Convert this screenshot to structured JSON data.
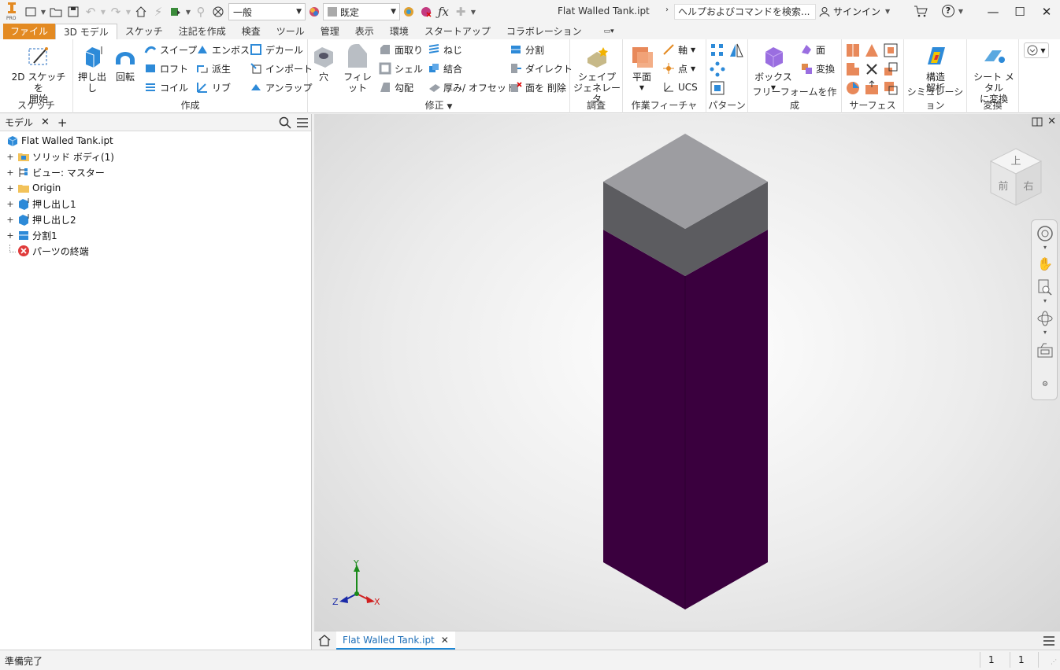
{
  "app": {
    "logo_text": "PRO",
    "style_dropdown": "一般",
    "appearance_dropdown": "既定",
    "document_title": "Flat Walled Tank.ipt",
    "help_search_placeholder": "ヘルプおよびコマンドを検索...",
    "signin_label": "サインイン"
  },
  "menu": {
    "tabs": [
      "ファイル",
      "3D モデル",
      "スケッチ",
      "注記を作成",
      "検査",
      "ツール",
      "管理",
      "表示",
      "環境",
      "スタートアップ",
      "コラボレーション"
    ]
  },
  "ribbon": {
    "sketch": {
      "start_line1": "2D スケッチを",
      "start_line2": "開始",
      "panel": "スケッチ"
    },
    "create": {
      "extrude": "押し出し",
      "revolve": "回転",
      "sweep": "スイープ",
      "loft": "ロフト",
      "coil": "コイル",
      "emboss": "エンボス",
      "derive": "派生",
      "rib": "リブ",
      "decal": "デカール",
      "import": "インポート",
      "unwrap": "アンラップ",
      "panel": "作成"
    },
    "modify": {
      "hole": "穴",
      "fillet": "フィレット",
      "chamfer": "面取り",
      "shell": "シェル",
      "draft": "勾配",
      "thread": "ねじ",
      "combine": "結合",
      "thicken": "厚み/ オフセット",
      "split": "分割",
      "direct": "ダイレクト",
      "delete_face": "面を 削除",
      "panel": "修正"
    },
    "explore": {
      "shape_line1": "シェイプ",
      "shape_line2": "ジェネレータ",
      "panel": "調査"
    },
    "work": {
      "plane": "平面",
      "axis": "軸",
      "point": "点",
      "ucs": "UCS",
      "panel": "作業フィーチャ"
    },
    "pattern": {
      "panel": "パターン"
    },
    "freeform": {
      "box": "ボックス",
      "face": "面",
      "convert": "変換",
      "panel": "フリーフォームを作成"
    },
    "surface": {
      "panel": "サーフェス"
    },
    "simulation": {
      "line1": "構造",
      "line2": "解析",
      "panel": "シミュレーション"
    },
    "convert": {
      "line1": "シート メタル",
      "line2": "に変換",
      "panel": "変換"
    }
  },
  "browser": {
    "title": "モデル",
    "items": [
      {
        "label": "Flat Walled Tank.ipt"
      },
      {
        "label": "ソリッド ボディ(1)"
      },
      {
        "label": "ビュー: マスター"
      },
      {
        "label": "Origin"
      },
      {
        "label": "押し出し1"
      },
      {
        "label": "押し出し2"
      },
      {
        "label": "分割1"
      },
      {
        "label": "パーツの終端"
      }
    ]
  },
  "viewcube": {
    "top": "上",
    "front": "前",
    "right": "右"
  },
  "axes": {
    "x": "X",
    "y": "Y",
    "z": "Z"
  },
  "doc_tab": {
    "label": "Flat Walled Tank.ipt"
  },
  "status": {
    "text": "準備完了",
    "count1": "1",
    "count2": "1"
  },
  "colors": {
    "accent": "#e38a22",
    "body_purple": "#3a003e",
    "top_gray": "#9c9ca0",
    "side_gray": "#5a5a5e"
  }
}
